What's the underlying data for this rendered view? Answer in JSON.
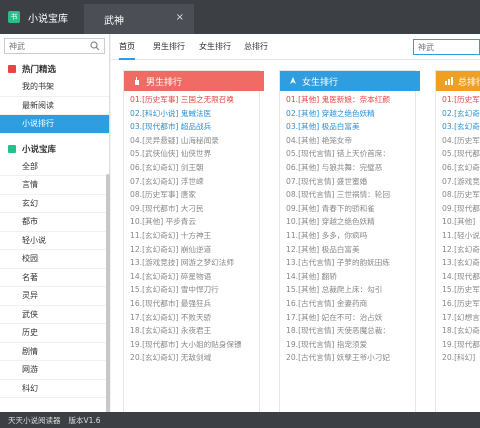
{
  "title_bar": {
    "app_title": "小说宝库",
    "active_tab": "武神",
    "close_glyph": "×"
  },
  "sidebar": {
    "search": {
      "placeholder": "",
      "value": "神武"
    },
    "groups": [
      {
        "title": "热门精选",
        "items": [
          "我的书架",
          "最新阅读",
          "小说排行"
        ]
      },
      {
        "title": "小说宝库",
        "items": [
          "全部",
          "言情",
          "玄幻",
          "都市",
          "轻小说",
          "校园",
          "名著",
          "灵异",
          "武侠",
          "历史",
          "剧情",
          "网游",
          "科幻"
        ]
      }
    ]
  },
  "main": {
    "nav_tabs": [
      "首页",
      "男生排行",
      "女生排行",
      "总排行"
    ],
    "search_value": "神武",
    "boards": [
      {
        "title": "男生排行",
        "color": "#f06b63",
        "rows": [
          "01.[历史军事] 三国之无限召唤",
          "02.[科幻小说] 鬼蜮法医",
          "03.[现代都市] 超品战兵",
          "04.[灵异悬疑] 山海秘闻录",
          "05.[武侠仙侠] 仙侠世界",
          "06.[玄幻奇幻] 剑王朝",
          "07.[玄幻奇幻] 浮世嵘",
          "08.[历史军事] 唐家",
          "09.[现代都市] 大刁民",
          "10.[其他] 平步青云",
          "11.[玄幻奇幻] 十方神王",
          "12.[玄幻奇幻] 崩仙逆道",
          "13.[游戏竞技] 网游之梦幻法师",
          "14.[玄幻奇幻] 碎星物语",
          "15.[玄幻奇幻] 雪中悍刀行",
          "16.[现代都市] 最强狂兵",
          "17.[玄幻奇幻] 不败天骄",
          "18.[玄幻奇幻] 永夜君王",
          "19.[现代都市] 大小姐的贴身保镖",
          "20.[玄幻奇幻] 无敌剑域"
        ]
      },
      {
        "title": "女生排行",
        "color": "#2f9ee0",
        "rows": [
          "01.[其他] 鬼医新娘：奈本红颜",
          "02.[其他] 穿越之绝色妖精",
          "03.[其他] 极品白富美",
          "04.[其他] 艳笼女帝",
          "05.[现代言情] 错上天价首席：",
          "06.[其他] 与狼共舞：完璧恶",
          "07.[现代言情] 盛世蜜婚",
          "08.[现代言情] 三世祸情：轮回",
          "09.[其他] 青春下的骄和雀",
          "10.[其他] 穿越之绝色妖精",
          "11.[其他] 多多，你疯吗",
          "12.[其他] 极品白富美",
          "13.[古代言情] 子萝的韵妩田练",
          "14.[其他] 翻轿",
          "15.[其他] 总裁爬上床：勾引",
          "16.[古代言情] 金妻药商",
          "17.[其他] 妃在不可：治占妖",
          "18.[现代言情] 天使恶魔总裁：",
          "19.[现代言情] 指宠须爱",
          "20.[古代言情] 妖孽王爷小刁妃"
        ]
      },
      {
        "title": "总排行",
        "color": "#f0a020",
        "rows": [
          "01.[历史军",
          "02.[玄幻奇",
          "03.[玄幻奇",
          "04.[历史军",
          "05.[现代都",
          "06.[玄幻奇",
          "07.[游戏竞",
          "08.[历史军",
          "09.[现代都",
          "10.[其他]",
          "11.[轻小说",
          "12.[玄幻奇",
          "13.[玄幻奇",
          "14.[现代都",
          "15.[历史军",
          "16.[历史军",
          "17.[幻想言",
          "18.[玄幻奇",
          "19.[现代都",
          "20.[科幻]"
        ]
      }
    ]
  },
  "status_bar": {
    "app_name": "天天小说阅读器",
    "version": "版本V1.6"
  }
}
